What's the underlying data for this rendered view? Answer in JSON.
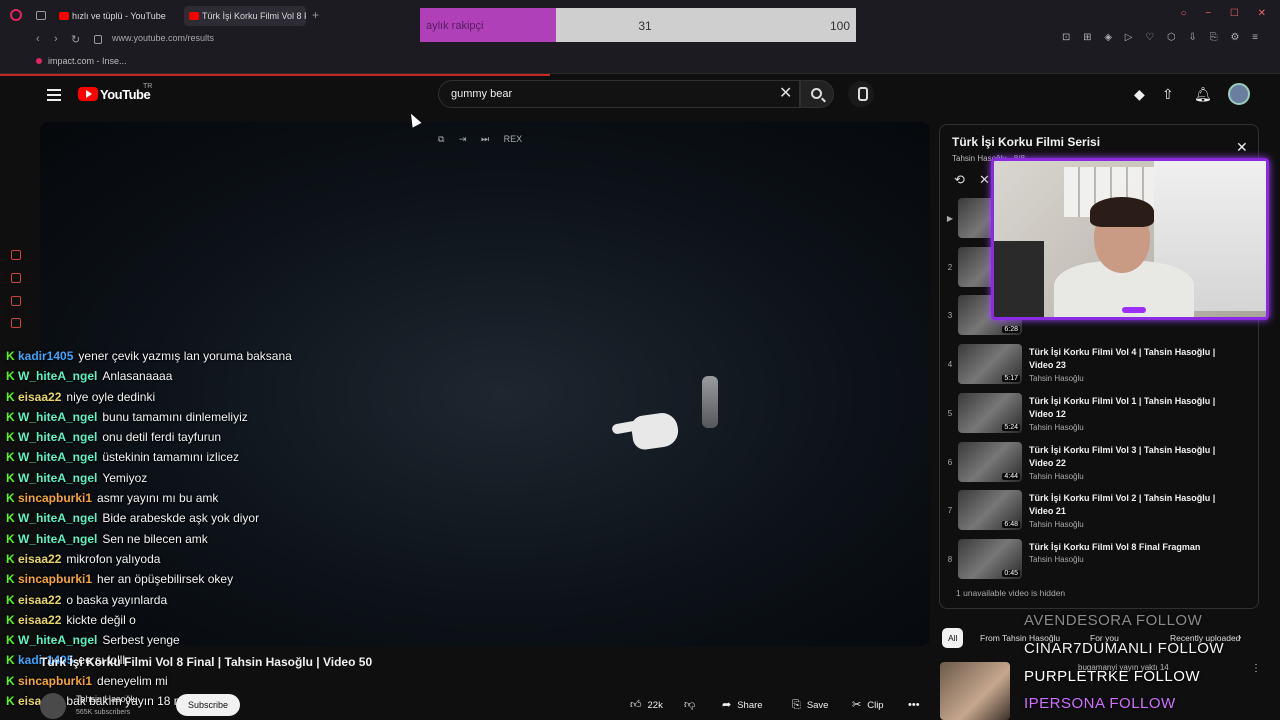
{
  "browser": {
    "tabs": [
      {
        "label": "hızlı ve tüplü - YouTube"
      },
      {
        "label": "Türk İşi Korku Filmi Vol 8 F"
      }
    ],
    "url": "www.youtube.com/results",
    "bookmark": "impact.com - Inse..."
  },
  "goal": {
    "label": "aylık rakipçi",
    "current": "31",
    "target": "100",
    "progress": 0.31,
    "fill_color": "#b040b8"
  },
  "header": {
    "logo_text": "YouTube",
    "region": "TR",
    "search_value": "gummy bear"
  },
  "player": {
    "mini_controls": [
      "⧉",
      "⇥",
      "⏭",
      "REX"
    ]
  },
  "chat": [
    {
      "user": "kadir1405",
      "color": "#3ea6ff",
      "msg": "yener çevik yazmış lan yoruma baksana"
    },
    {
      "user": "W_hiteA_ngel",
      "color": "#5cf4c4",
      "msg": "Anlasanaaaa"
    },
    {
      "user": "eisaa22",
      "color": "#e8d56a",
      "msg": "niye oyle dedinki"
    },
    {
      "user": "W_hiteA_ngel",
      "color": "#5cf4c4",
      "msg": "bunu tamamını dinlemeliyiz"
    },
    {
      "user": "W_hiteA_ngel",
      "color": "#5cf4c4",
      "msg": "onu detil ferdi tayfurun"
    },
    {
      "user": "W_hiteA_ngel",
      "color": "#5cf4c4",
      "msg": "üstekinin tamamını izlicez"
    },
    {
      "user": "W_hiteA_ngel",
      "color": "#5cf4c4",
      "msg": "Yemiyoz"
    },
    {
      "user": "sincapburki1",
      "color": "#f4a63a",
      "msg": "asmr yayını mı bu amk"
    },
    {
      "user": "W_hiteA_ngel",
      "color": "#5cf4c4",
      "msg": "Bide arabeskde aşk yok diyor"
    },
    {
      "user": "W_hiteA_ngel",
      "color": "#5cf4c4",
      "msg": "Sen ne bilecen amk"
    },
    {
      "user": "eisaa22",
      "color": "#e8d56a",
      "msg": "mikrofon yalıyoda"
    },
    {
      "user": "sincapburki1",
      "color": "#f4a63a",
      "msg": "her an öpüşebilirsek okey"
    },
    {
      "user": "eisaa22",
      "color": "#e8d56a",
      "msg": "o baska yayınlarda"
    },
    {
      "user": "eisaa22",
      "color": "#e8d56a",
      "msg": "kickte değil o"
    },
    {
      "user": "W_hiteA_ngel",
      "color": "#5cf4c4",
      "msg": "Serbest yenge"
    },
    {
      "user": "kadir1405",
      "color": "#3ea6ff",
      "msg": "ee sı lolll"
    },
    {
      "user": "sincapburki1",
      "color": "#f4a63a",
      "msg": "deneyelim mi"
    },
    {
      "user": "eisaa22",
      "color": "#e8d56a",
      "msg": "bak bakım yayın 18 mi"
    }
  ],
  "video": {
    "title": "Türk İşi Korku Filmi Vol 8 Final | Tahsin Hasoğlu | Video 50",
    "channel": "Tahsin Hasoğlu",
    "subscribers": "565K subscribers",
    "subscribe_label": "Subscribe",
    "likes": "22k",
    "share_label": "Share",
    "save_label": "Save",
    "clip_label": "Clip"
  },
  "playlist": {
    "title": "Türk İşi Korku Filmi Serisi",
    "owner": "Tahsin Hasoğlu - 8/8",
    "hidden_note": "1 unavailable video is hidden",
    "items": [
      {
        "index": "▶",
        "title": "",
        "channel": "",
        "duration": ""
      },
      {
        "index": "2",
        "title": "",
        "channel": "",
        "duration": ""
      },
      {
        "index": "3",
        "title": "",
        "channel": "Tahsin Hasoğlu",
        "duration": "6:28"
      },
      {
        "index": "4",
        "title": "Türk İşi Korku Filmi Vol 4 | Tahsin Hasoğlu | Video 23",
        "channel": "Tahsin Hasoğlu",
        "duration": "5:17"
      },
      {
        "index": "5",
        "title": "Türk İşi Korku Filmi Vol 1 | Tahsin Hasoğlu | Video 12",
        "channel": "Tahsin Hasoğlu",
        "duration": "5:24"
      },
      {
        "index": "6",
        "title": "Türk İşi Korku Filmi Vol 3 | Tahsin Hasoğlu | Video 22",
        "channel": "Tahsin Hasoğlu",
        "duration": "4:44"
      },
      {
        "index": "7",
        "title": "Türk İşi Korku Filmi Vol 2 | Tahsin Hasoğlu | Video 21",
        "channel": "Tahsin Hasoğlu",
        "duration": "6:48"
      },
      {
        "index": "8",
        "title": "Türk İşi Korku Filmi Vol 8 Final Fragman",
        "channel": "Tahsin Hasoğlu",
        "duration": "0:45"
      }
    ]
  },
  "chips": [
    "All",
    "From Tahsin Hasoğlu",
    "For you",
    "Recently uploaded"
  ],
  "recommendation": {
    "title": "bugamanyi yayın yaktı 14"
  },
  "follows": [
    {
      "text": "AVENDESORA  FOLLOW",
      "color": "#8a8a8a"
    },
    {
      "text": "CINAR7DUMANLI  FOLLOW",
      "color": "#f2f2f2"
    },
    {
      "text": "PURPLETRKE  FOLLOW",
      "color": "#ffffff"
    },
    {
      "text": "IPERSONA  FOLLOW",
      "color": "#d070ff"
    }
  ]
}
